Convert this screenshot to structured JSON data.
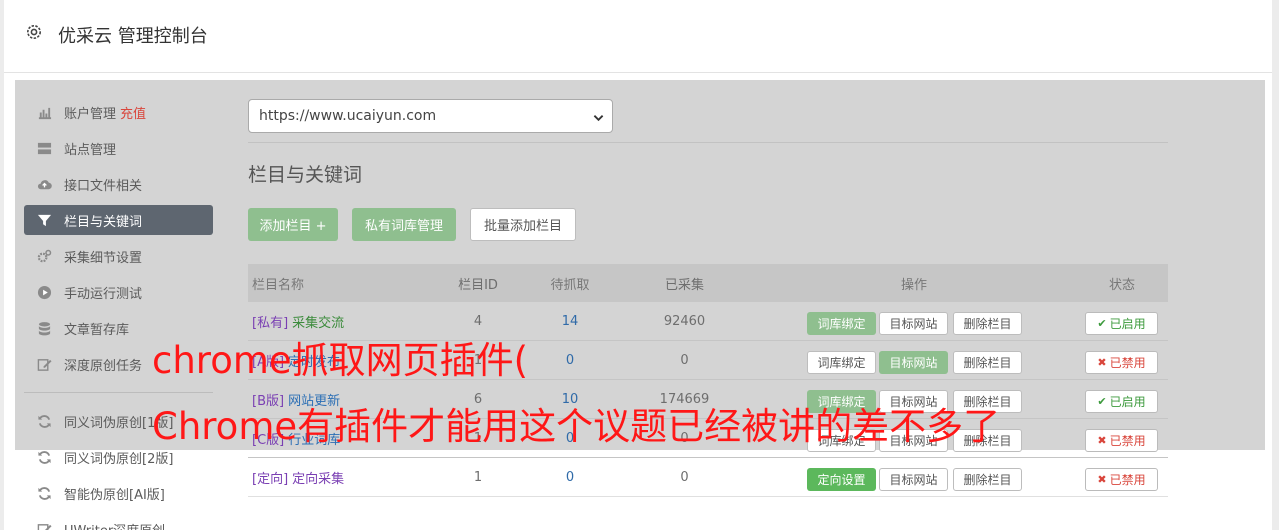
{
  "header": {
    "title": "优采云 管理控制台",
    "icon": "gear-icon"
  },
  "sidebar": {
    "items": [
      {
        "label": "账户管理",
        "extra": "充值",
        "icon": "bar-chart-icon"
      },
      {
        "label": "站点管理",
        "icon": "server-icon"
      },
      {
        "label": "接口文件相关",
        "icon": "cloud-upload-icon"
      },
      {
        "label": "栏目与关键词",
        "icon": "filter-icon",
        "active": true
      },
      {
        "label": "采集细节设置",
        "icon": "cogs-icon"
      },
      {
        "label": "手动运行测试",
        "icon": "play-icon"
      },
      {
        "label": "文章暂存库",
        "icon": "database-icon"
      },
      {
        "label": "深度原创任务",
        "icon": "edit-icon"
      },
      {
        "label": "同义词伪原创[1版]",
        "icon": "refresh-icon"
      },
      {
        "label": "同义词伪原创[2版]",
        "icon": "refresh-icon"
      },
      {
        "label": "智能伪原创[AI版]",
        "icon": "refresh-icon"
      },
      {
        "label": "UWriter深度原创",
        "icon": "edit-icon"
      }
    ]
  },
  "main": {
    "site_select": {
      "value": "https://www.ucaiyun.com"
    },
    "section_title": "栏目与关键词",
    "buttons": {
      "add_column": "添加栏目 +",
      "private_lib": "私有词库管理",
      "batch_add": "批量添加栏目"
    },
    "table": {
      "headers": {
        "name": "栏目名称",
        "id": "栏目ID",
        "pending": "待抓取",
        "collected": "已采集",
        "ops": "操作",
        "status": "状态"
      },
      "rows": [
        {
          "tag": "[私有]",
          "name": "采集交流",
          "id": "4",
          "pending": "14",
          "collected": "92460",
          "op1": "词库绑定",
          "op2": "目标网站",
          "op3": "删除栏目",
          "status": "已启用"
        },
        {
          "tag": "[A版]",
          "name": "定时发布",
          "id": "1",
          "pending": "0",
          "collected": "0",
          "op1": "词库绑定",
          "op2": "目标网站",
          "op3": "删除栏目",
          "status": "已禁用"
        },
        {
          "tag": "[B版]",
          "name": "网站更新",
          "id": "6",
          "pending": "10",
          "collected": "174669",
          "op1": "词库绑定",
          "op2": "目标网站",
          "op3": "删除栏目",
          "status": "已启用"
        },
        {
          "tag": "[C版]",
          "name": "行业词库",
          "id": "1",
          "pending": "0",
          "collected": "0",
          "op1": "词库绑定",
          "op2": "目标网站",
          "op3": "删除栏目",
          "status": "已禁用"
        },
        {
          "tag": "[定向]",
          "name": "定向采集",
          "id": "1",
          "pending": "0",
          "collected": "0",
          "op1": "定向设置",
          "op2": "目标网站",
          "op3": "删除栏目",
          "status": "已禁用"
        }
      ]
    }
  },
  "overlay": {
    "line1": "chrome抓取网页插件(",
    "line2": "Chrome有插件才能用这个议题已经被讲的差不多了",
    "color": "#ff1717"
  }
}
